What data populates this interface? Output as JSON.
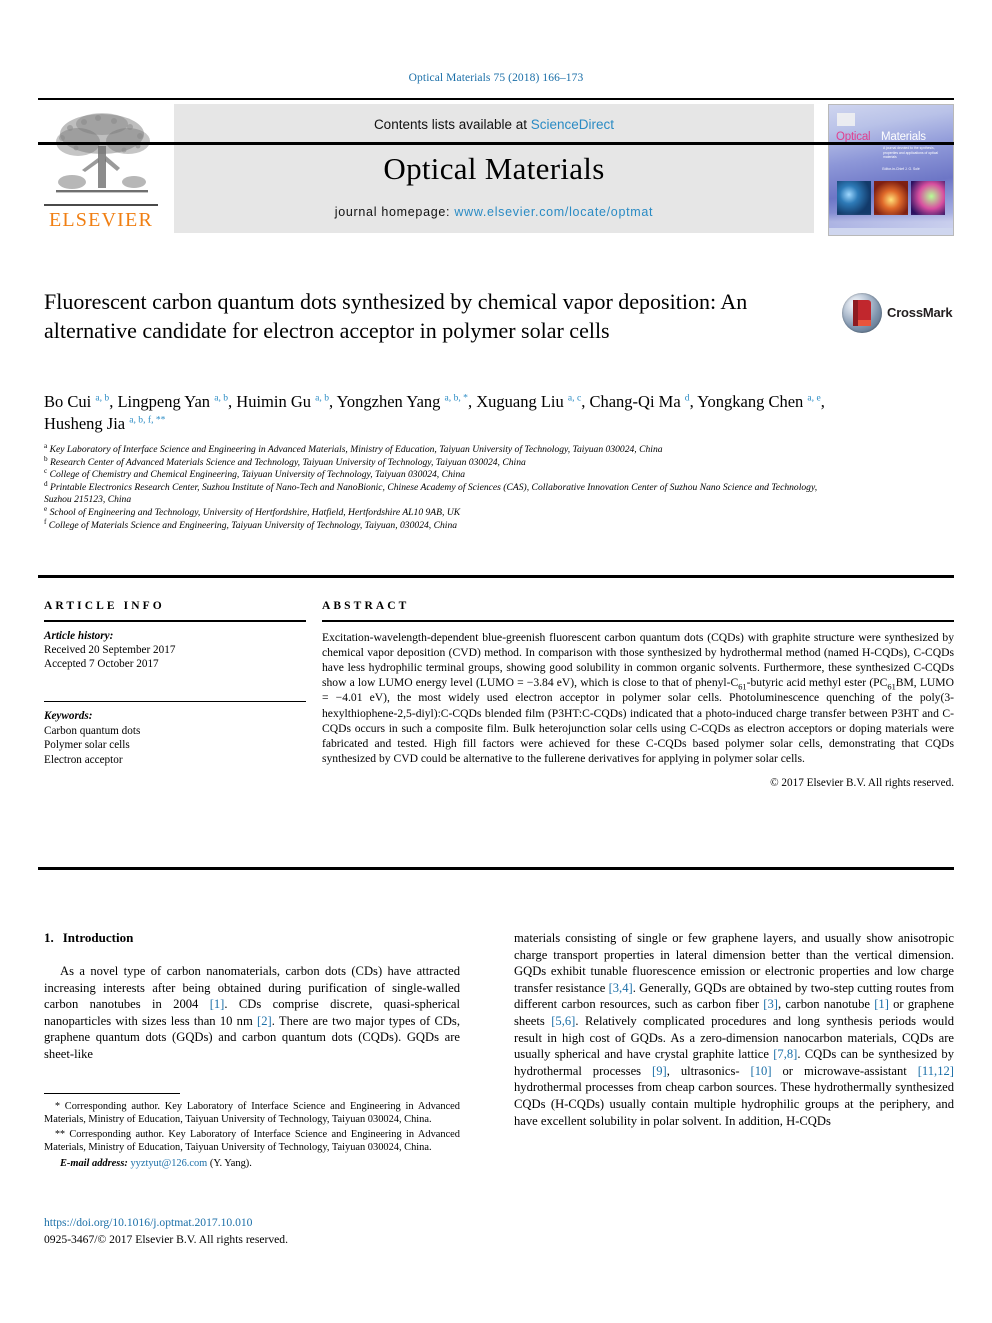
{
  "running_head": "Optical Materials 75 (2018) 166–173",
  "masthead": {
    "contents_prefix": "Contents lists available at ",
    "sciencedirect": "ScienceDirect",
    "journal_title": "Optical Materials",
    "homepage_prefix": "journal homepage: ",
    "homepage_url": "www.elsevier.com/locate/optmat",
    "publisher": "ELSEVIER",
    "cover": {
      "title_part1": "Optical",
      "title_part2": "Materials",
      "subtitle": "A journal devoted to the synthesis, properties and applications of optical materials",
      "editor": "Editor-in-Chief\nJ. G. Solé"
    }
  },
  "article": {
    "title": "Fluorescent carbon quantum dots synthesized by chemical vapor deposition: An alternative candidate for electron acceptor in polymer solar cells",
    "crossmark_label": "CrossMark",
    "authors": [
      {
        "name": "Bo Cui",
        "marks": "a, b",
        "sep": ", "
      },
      {
        "name": "Lingpeng Yan",
        "marks": "a, b",
        "sep": ", "
      },
      {
        "name": "Huimin Gu",
        "marks": "a, b",
        "sep": ", "
      },
      {
        "name": "Yongzhen Yang",
        "marks": "a, b, *",
        "sep": ", "
      },
      {
        "name": "Xuguang Liu",
        "marks": "a, c",
        "sep": ", "
      },
      {
        "name": "Chang-Qi Ma",
        "marks": "d",
        "sep": ", "
      },
      {
        "name": "Yongkang Chen",
        "marks": "a, e",
        "sep": ", "
      },
      {
        "name": "Husheng Jia",
        "marks": "a, b, f, **",
        "sep": ""
      }
    ],
    "affiliations": [
      {
        "mark": "a",
        "text": "Key Laboratory of Interface Science and Engineering in Advanced Materials, Ministry of Education, Taiyuan University of Technology, Taiyuan 030024, China"
      },
      {
        "mark": "b",
        "text": "Research Center of Advanced Materials Science and Technology, Taiyuan University of Technology, Taiyuan 030024, China"
      },
      {
        "mark": "c",
        "text": "College of Chemistry and Chemical Engineering, Taiyuan University of Technology, Taiyuan 030024, China"
      },
      {
        "mark": "d",
        "text": "Printable Electronics Research Center, Suzhou Institute of Nano-Tech and NanoBionic, Chinese Academy of Sciences (CAS), Collaborative Innovation Center of Suzhou Nano Science and Technology, Suzhou 215123, China"
      },
      {
        "mark": "e",
        "text": "School of Engineering and Technology, University of Hertfordshire, Hatfield, Hertfordshire AL10 9AB, UK"
      },
      {
        "mark": "f",
        "text": "College of Materials Science and Engineering, Taiyuan University of Technology, Taiyuan, 030024, China"
      }
    ]
  },
  "article_info": {
    "heading": "ARTICLE INFO",
    "history_label": "Article history:",
    "history": [
      "Received 20 September 2017",
      "Accepted 7 October 2017"
    ],
    "keywords_label": "Keywords:",
    "keywords": [
      "Carbon quantum dots",
      "Polymer solar cells",
      "Electron acceptor"
    ]
  },
  "abstract": {
    "heading": "ABSTRACT",
    "paragraph_part1": "Excitation-wavelength-dependent blue-greenish fluorescent carbon quantum dots (CQDs) with graphite structure were synthesized by chemical vapor deposition (CVD) method. In comparison with those synthesized by hydrothermal method (named H-CQDs), C-CQDs have less hydrophilic terminal groups, showing good solubility in common organic solvents. Furthermore, these synthesized C-CQDs show a low LUMO energy level (LUMO = −3.84 eV), which is close to that of phenyl-C",
    "sub1": "61",
    "paragraph_part2": "-butyric acid methyl ester (PC",
    "sub2": "61",
    "paragraph_part3": "BM, LUMO = −4.01 eV), the most widely used electron acceptor in polymer solar cells. Photoluminescence quenching of the poly(3-hexylthiophene-2,5-diyl):C-CQDs blended film (P3HT:C-CQDs) indicated that a photo-induced charge transfer between P3HT and C-CQDs occurs in such a composite film. Bulk heterojunction solar cells using C-CQDs as electron acceptors or doping materials were fabricated and tested. High fill factors were achieved for these C-CQDs based polymer solar cells, demonstrating that CQDs synthesized by CVD could be alternative to the fullerene derivatives for applying in polymer solar cells.",
    "copyright": "© 2017 Elsevier B.V. All rights reserved."
  },
  "introduction": {
    "number": "1.",
    "heading": "Introduction",
    "left_p1_a": "As a novel type of carbon nanomaterials, carbon dots (CDs) have attracted increasing interests after being obtained during purification of single-walled carbon nanotubes in 2004 ",
    "left_ref1": "[1]",
    "left_p1_b": ". CDs comprise discrete, quasi-spherical nanoparticles with sizes less than 10 nm ",
    "left_ref2": "[2]",
    "left_p1_c": ". There are two major types of CDs, graphene quantum dots (GQDs) and carbon quantum dots (CQDs). GQDs are sheet-like",
    "right_p1_a": "materials consisting of single or few graphene layers, and usually show anisotropic charge transport properties in lateral dimension better than the vertical dimension. GQDs exhibit tunable fluorescence emission or electronic properties and low charge transfer resistance ",
    "right_ref1": "[3,4]",
    "right_p1_b": ". Generally, GQDs are obtained by two-step cutting routes from different carbon resources, such as carbon fiber ",
    "right_ref2": "[3]",
    "right_p1_c": ", carbon nanotube ",
    "right_ref3": "[1]",
    "right_p1_d": " or graphene sheets ",
    "right_ref4": "[5,6]",
    "right_p1_e": ". Relatively complicated procedures and long synthesis periods would result in high cost of GQDs. As a zero-dimension nanocarbon materials, CQDs are usually spherical and have crystal graphite lattice ",
    "right_ref5": "[7,8]",
    "right_p1_f": ". CQDs can be synthesized by hydrothermal processes ",
    "right_ref6": "[9]",
    "right_p1_g": ", ultrasonics- ",
    "right_ref7": "[10]",
    "right_p1_h": " or microwave-assistant ",
    "right_ref8": "[11,12]",
    "right_p1_i": " hydrothermal processes from cheap carbon sources. These hydrothermally synthesized CQDs (H-CQDs) usually contain multiple hydrophilic groups at the periphery, and have excellent solubility in polar solvent. In addition, H-CQDs"
  },
  "footnotes": {
    "star1": "*",
    "note1": " Corresponding author. Key Laboratory of Interface Science and Engineering in Advanced Materials, Ministry of Education, Taiyuan University of Technology, Taiyuan 030024, China.",
    "star2": "**",
    "note2": " Corresponding author. Key Laboratory of Interface Science and Engineering in Advanced Materials, Ministry of Education, Taiyuan University of Technology, Taiyuan 030024, China.",
    "email_label": "E-mail address:",
    "email": "yyztyut@126.com",
    "email_owner": " (Y. Yang).",
    "doi": "https://doi.org/10.1016/j.optmat.2017.10.010",
    "issn_line": "0925-3467/© 2017 Elsevier B.V. All rights reserved."
  },
  "colors": {
    "link": "#1b6fa8",
    "accent": "#2a8bc4",
    "elsevier_orange": "#f07f13",
    "band_gray": "#e6e6e6"
  }
}
